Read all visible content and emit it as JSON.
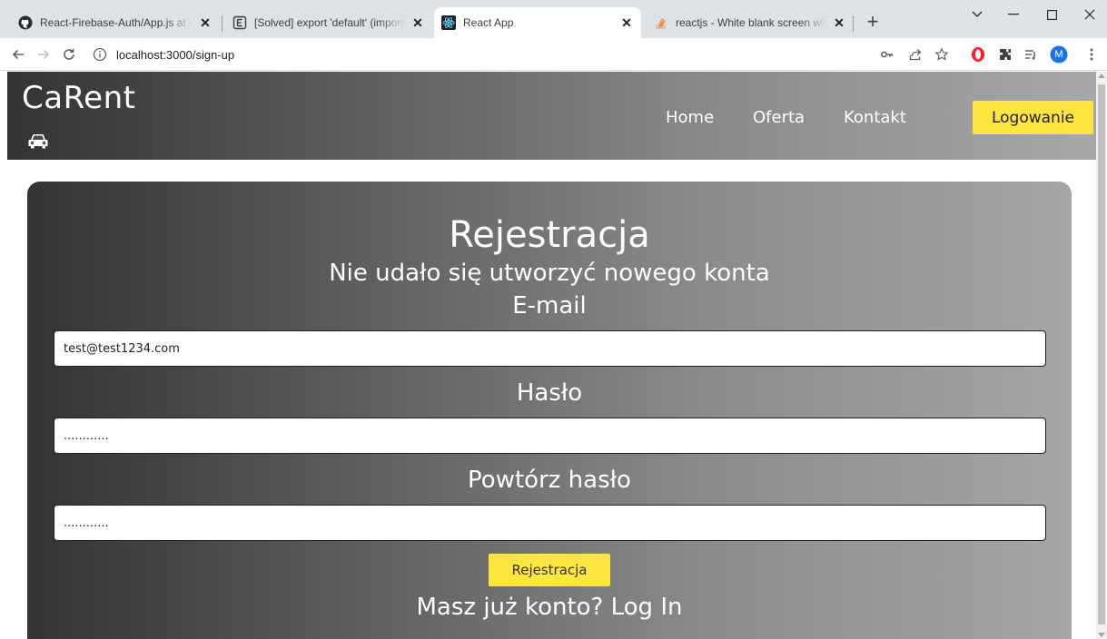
{
  "browser": {
    "tabs": [
      {
        "title": "React-Firebase-Auth/App.js at m",
        "icon": "github-icon",
        "active": false
      },
      {
        "title": "[Solved] export 'default' (importe",
        "icon": "e-icon",
        "active": false
      },
      {
        "title": "React App",
        "icon": "react-icon",
        "active": true
      },
      {
        "title": "reactjs - White blank screen whe",
        "icon": "stackoverflow-icon",
        "active": false
      }
    ],
    "new_tab": "+",
    "url": "localhost:3000/sign-up",
    "profile_initial": "M"
  },
  "site": {
    "logo": "CaRent",
    "nav": [
      "Home",
      "Oferta",
      "Kontakt"
    ],
    "login_button": "Logowanie"
  },
  "form": {
    "title": "Rejestracja",
    "error": "Nie udało się utworzyć nowego konta",
    "email_label": "E-mail",
    "email_value": "test@test1234.com",
    "password_label": "Hasło",
    "password_value": "............",
    "repeat_label": "Powtórz hasło",
    "repeat_value": "............",
    "submit": "Rejestracja",
    "login_prompt": "Masz już konto?",
    "login_link": "Log In"
  },
  "colors": {
    "accent": "#ffe540",
    "gradient_start": "#333333",
    "gradient_end": "#a8a8a8"
  }
}
